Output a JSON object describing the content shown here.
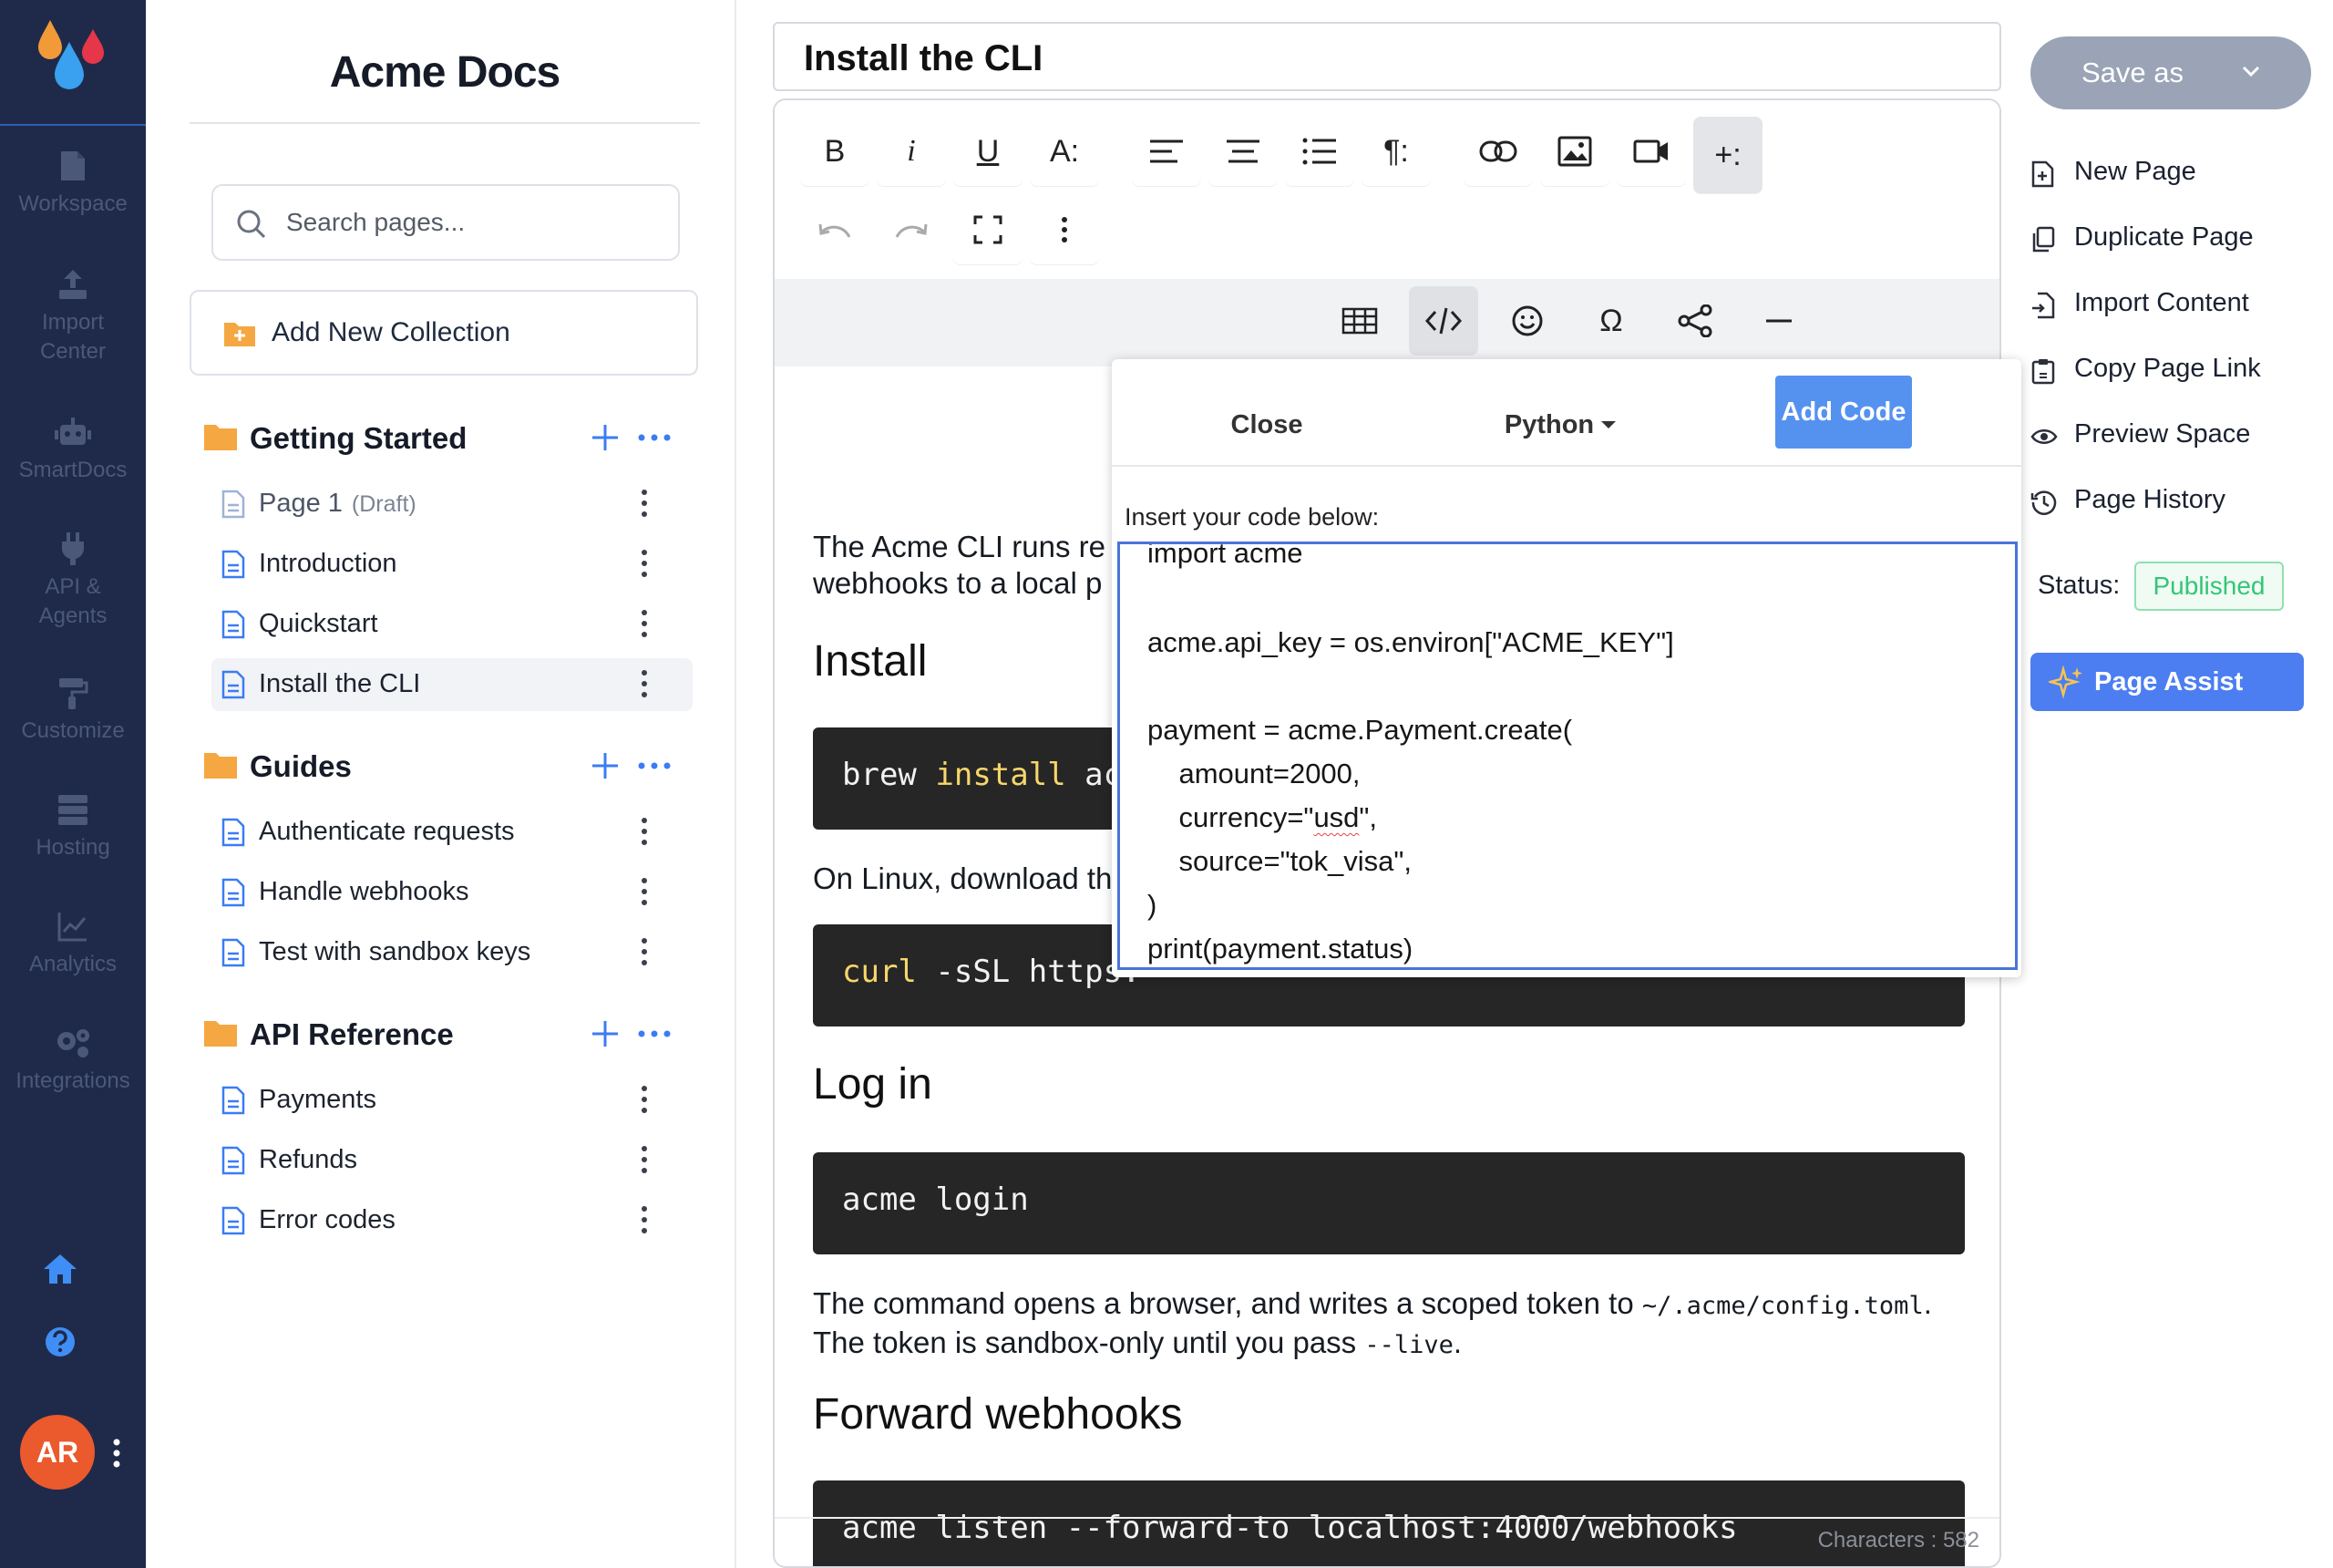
{
  "rail": {
    "items": [
      {
        "label": "Workspace",
        "icon": "document-icon"
      },
      {
        "label": "Import Center",
        "icon": "upload-icon"
      },
      {
        "label": "SmartDocs",
        "icon": "robot-icon"
      },
      {
        "label": "API & Agents",
        "icon": "plug-icon"
      },
      {
        "label": "Customize",
        "icon": "paint-roller-icon"
      },
      {
        "label": "Hosting",
        "icon": "server-icon"
      },
      {
        "label": "Analytics",
        "icon": "chart-icon"
      },
      {
        "label": "Integrations",
        "icon": "gears-icon"
      }
    ],
    "avatar_initials": "AR",
    "colors": {
      "background": "#1f2a4a",
      "muted_text": "#4c5877",
      "avatar": "#ea5a2d"
    }
  },
  "sidebar": {
    "brand": "Acme Docs",
    "search_placeholder": "Search pages...",
    "add_collection_label": "Add New Collection",
    "collections": [
      {
        "name": "Getting Started",
        "pages": [
          {
            "title": "Page 1",
            "tag": "(Draft)"
          },
          {
            "title": "Introduction"
          },
          {
            "title": "Quickstart"
          },
          {
            "title": "Install the CLI"
          }
        ]
      },
      {
        "name": "Guides",
        "pages": [
          {
            "title": "Authenticate requests"
          },
          {
            "title": "Handle webhooks"
          },
          {
            "title": "Test with sandbox keys"
          }
        ]
      },
      {
        "name": "API Reference",
        "pages": [
          {
            "title": "Payments"
          },
          {
            "title": "Refunds"
          },
          {
            "title": "Error codes"
          }
        ]
      }
    ],
    "active_page": "Install the CLI"
  },
  "editor": {
    "page_title": "Install the CLI",
    "toolbar": {
      "bold": "B",
      "italic": "i",
      "underline": "U",
      "font_size": "A:",
      "paragraph": "¶:",
      "more_insert": "+:",
      "omega": "Ω"
    },
    "content": {
      "intro_line1": "The Acme CLI runs re",
      "intro_line2": "webhooks to a local p",
      "h_install": "Install",
      "code_install_cmd": "brew",
      "code_install_kw": "install",
      "code_install_rest": "acr",
      "linux_text": "On Linux, download th",
      "code_curl_kw": "curl",
      "code_curl_rest": "-sSL https:",
      "h_login": "Log in",
      "code_login": "acme login",
      "login_text_a": "The command opens a browser, and writes a scoped token to ",
      "login_path": "~/.acme/config.toml",
      "login_text_b": ".",
      "token_text_a": "The token is sandbox-only until you pass ",
      "token_flag": "--live",
      "token_text_b": ".",
      "h_webhooks": "Forward webhooks",
      "code_listen": "acme listen --forward-to localhost:4000/webhooks"
    },
    "char_count": "Characters : 582"
  },
  "code_popup": {
    "close_label": "Close",
    "language": "Python",
    "add_label": "Add Code",
    "instruction": "Insert your code below:",
    "lines": [
      "import acme",
      "",
      "acme.api_key = os.environ[\"ACME_KEY\"]",
      "",
      "payment = acme.Payment.create(",
      "    amount=2000,",
      "    currency=\"usd\",",
      "    source=\"tok_visa\",",
      ")",
      "print(payment.status)"
    ]
  },
  "right_panel": {
    "save_as_label": "Save as",
    "actions": [
      {
        "label": "New Page",
        "icon": "file-plus-icon"
      },
      {
        "label": "Duplicate Page",
        "icon": "copy-icon"
      },
      {
        "label": "Import Content",
        "icon": "file-import-icon"
      },
      {
        "label": "Copy Page Link",
        "icon": "clipboard-link-icon"
      },
      {
        "label": "Preview Space",
        "icon": "eye-icon"
      },
      {
        "label": "Page History",
        "icon": "history-icon"
      }
    ],
    "status_label": "Status:",
    "status_value": "Published",
    "assist_label": "Page Assist",
    "colors": {
      "save_as": "#9aa4b6",
      "published_text": "#35c577",
      "assist": "#4c7ef2",
      "add_code": "#5592f0"
    }
  }
}
